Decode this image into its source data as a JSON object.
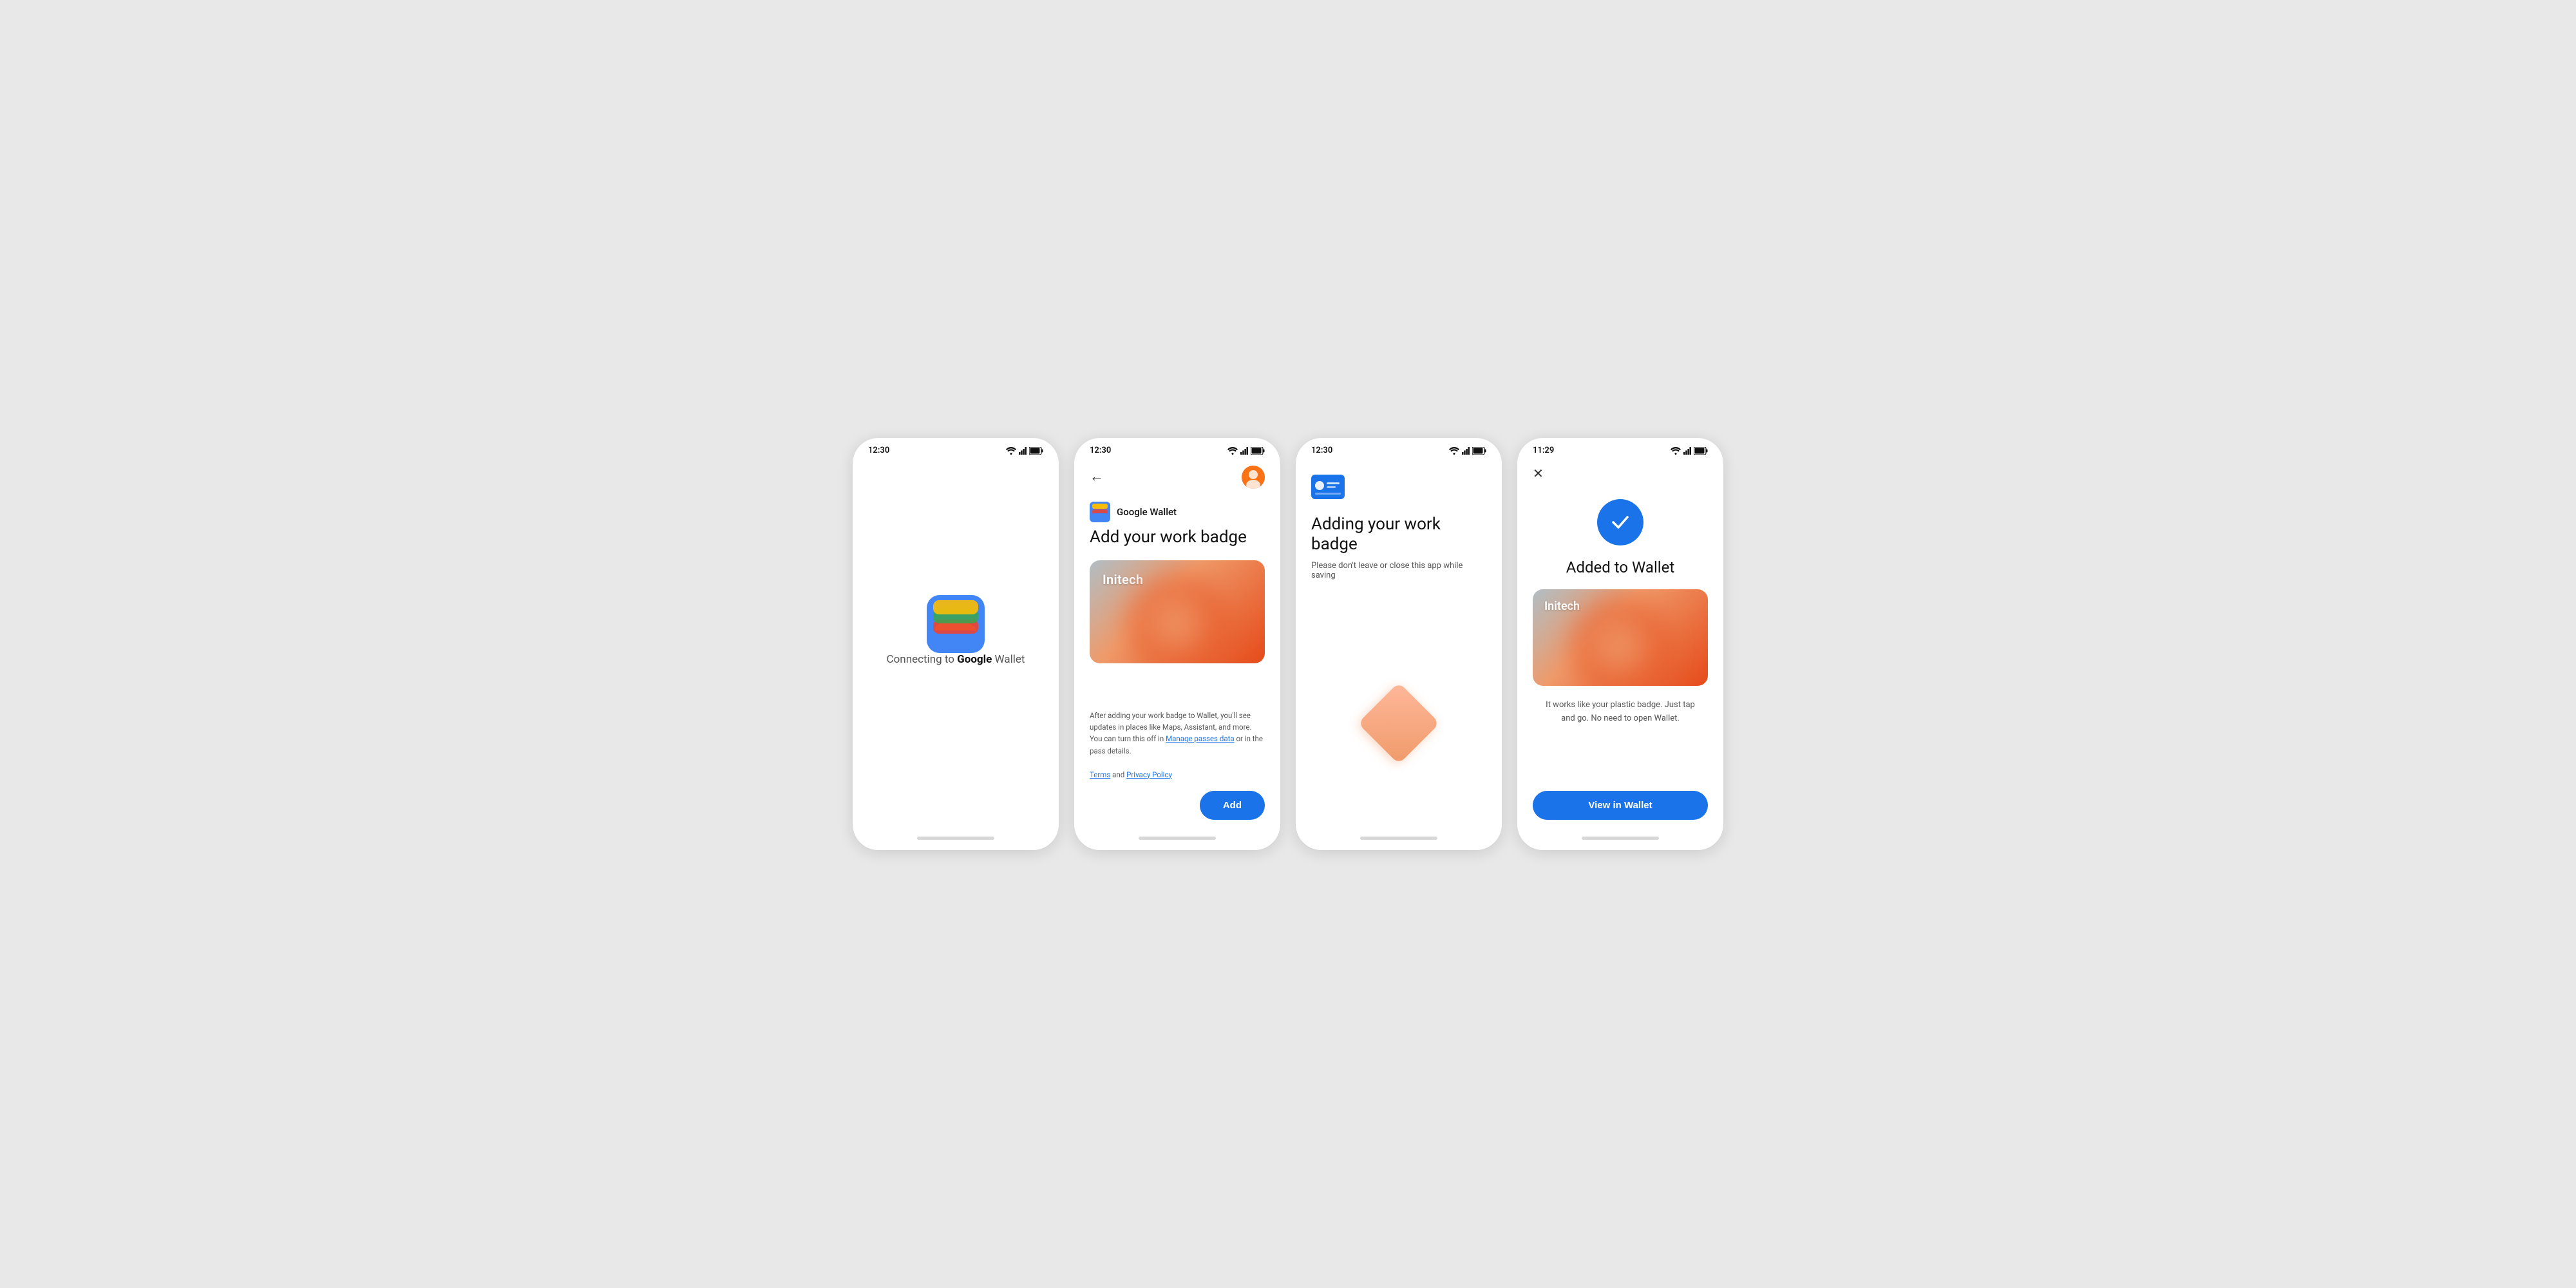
{
  "screens": [
    {
      "id": "screen1",
      "statusBar": {
        "time": "12:30"
      },
      "content": {
        "connectingText": "Connecting to ",
        "googleText": "Google",
        "walletText": " Wallet"
      }
    },
    {
      "id": "screen2",
      "statusBar": {
        "time": "12:30"
      },
      "content": {
        "logoText": "Google Wallet",
        "title": "Add your work badge",
        "badgeName": "Initech",
        "termsBody": "After adding your work badge to Wallet, you'll see updates in places like Maps, Assistant, and more. You can turn this off in ",
        "manageLink": "Manage passes data",
        "termsMid": " or in the pass details.",
        "termsLine2": " and ",
        "termsLabel": "Terms",
        "privacyLabel": "Privacy Policy",
        "addButton": "Add"
      }
    },
    {
      "id": "screen3",
      "statusBar": {
        "time": "12:30"
      },
      "content": {
        "title": "Adding your work badge",
        "subtitle": "Please don't leave or close this app while saving"
      }
    },
    {
      "id": "screen4",
      "statusBar": {
        "time": "11:29"
      },
      "content": {
        "title": "Added to Wallet",
        "badgeName": "Initech",
        "tapGoText": "It works like your plastic badge. Just tap and go. No need to open Wallet.",
        "viewButton": "View in Wallet"
      }
    }
  ]
}
